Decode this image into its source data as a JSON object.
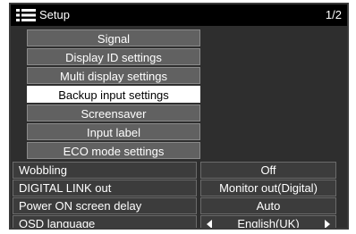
{
  "header": {
    "title": "Setup",
    "page_indicator": "1/2",
    "icon": "menu-list-icon"
  },
  "submenu_items": [
    {
      "label": "Signal",
      "selected": false
    },
    {
      "label": "Display ID settings",
      "selected": false
    },
    {
      "label": "Multi display settings",
      "selected": false
    },
    {
      "label": "Backup input settings",
      "selected": true
    },
    {
      "label": "Screensaver",
      "selected": false
    },
    {
      "label": "Input label",
      "selected": false
    },
    {
      "label": "ECO mode settings",
      "selected": false
    }
  ],
  "settings": [
    {
      "label": "Wobbling",
      "value": "Off"
    },
    {
      "label": "DIGITAL LINK out",
      "value": "Monitor out(Digital)"
    },
    {
      "label": "Power ON screen delay",
      "value": "Auto"
    },
    {
      "label": "OSD language",
      "value": "English(UK)",
      "has_arrows": true
    }
  ],
  "colors": {
    "title_bar": "#000000",
    "panel": "#2e2e2e",
    "submenu_item": "#616161",
    "selected_item": "#ffffff"
  }
}
